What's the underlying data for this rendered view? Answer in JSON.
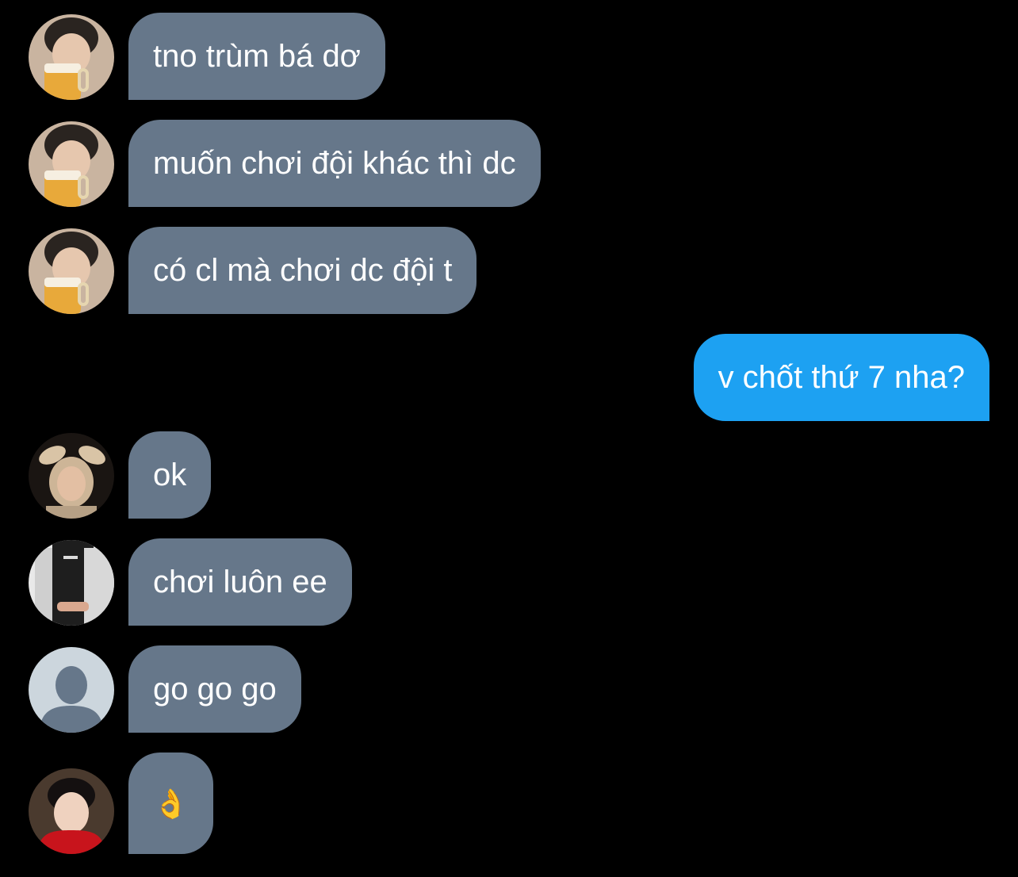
{
  "conversation": {
    "messages": [
      {
        "sender": "friend-1",
        "direction": "received",
        "text": "tno trùm bá dơ"
      },
      {
        "sender": "friend-1",
        "direction": "received",
        "text": "muốn chơi đội khác thì dc"
      },
      {
        "sender": "friend-1",
        "direction": "received",
        "text": "có cl mà chơi dc đội t"
      },
      {
        "sender": "me",
        "direction": "sent",
        "text": "v chốt thứ 7 nha?"
      },
      {
        "sender": "friend-2",
        "direction": "received",
        "text": "ok"
      },
      {
        "sender": "friend-3",
        "direction": "received",
        "text": "chơi luôn ee"
      },
      {
        "sender": "friend-4",
        "direction": "received",
        "text": "go go go"
      },
      {
        "sender": "friend-5",
        "direction": "received",
        "text": "👌",
        "icon": "ok-hand-emoji-icon"
      }
    ]
  },
  "colors": {
    "background": "#000000",
    "received_bubble": "#66778a",
    "sent_bubble": "#1da1f2",
    "text": "#ffffff"
  }
}
